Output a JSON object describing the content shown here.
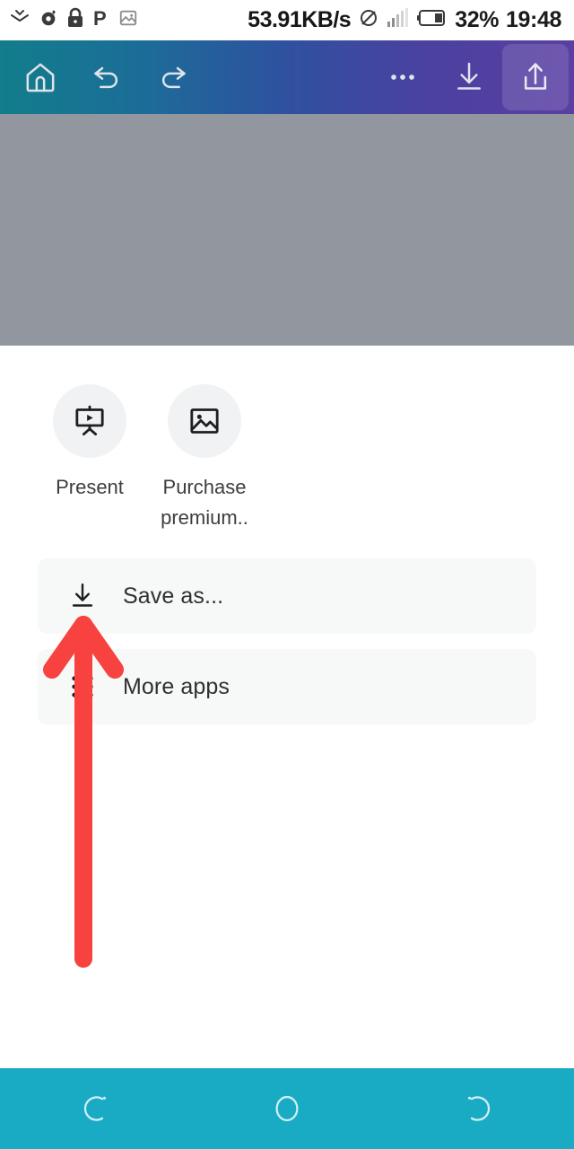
{
  "statusbar": {
    "left_icons": [
      {
        "name": "missed-call-icon"
      },
      {
        "name": "alarm-icon"
      },
      {
        "name": "lock-icon"
      },
      {
        "name": "parking-p-icon"
      },
      {
        "name": "screenshot-image-icon"
      }
    ],
    "network_speed": "53.91KB/s",
    "right_icons": [
      {
        "name": "mute-vibrate-off-icon"
      },
      {
        "name": "signal-bars-icon"
      },
      {
        "name": "battery-icon"
      }
    ],
    "battery_percent": "32%",
    "clock": "19:48"
  },
  "toolbar": {
    "gradient_start": "#127d8b",
    "gradient_end": "#5b3fa2",
    "buttons": [
      {
        "name": "home-icon",
        "label": "Home"
      },
      {
        "name": "undo-icon",
        "label": "Undo"
      },
      {
        "name": "redo-icon",
        "label": "Redo"
      },
      {
        "name": "more-options-icon",
        "label": "More options"
      },
      {
        "name": "download-icon",
        "label": "Download"
      },
      {
        "name": "share-export-icon",
        "label": "Share",
        "selected": true
      }
    ]
  },
  "canvas": {
    "background_color": "#92969e"
  },
  "sheet": {
    "background_color": "#ffffff",
    "quick_actions": [
      {
        "icon": "present-screen-icon",
        "label": "Present"
      },
      {
        "icon": "image-picture-icon",
        "label": "Purchase premium.."
      }
    ],
    "list_items": [
      {
        "icon": "download-icon",
        "label": "Save as..."
      },
      {
        "icon": "apps-grid-icon",
        "label": "More apps"
      }
    ],
    "row_background": "#f7f8f8"
  },
  "annotation": {
    "name": "red-arrow-pointer",
    "color": "#f8423f",
    "points_at": "Save as..."
  },
  "navbar": {
    "background_color": "#1aabc4",
    "buttons": [
      {
        "name": "back-icon",
        "label": "Back"
      },
      {
        "name": "home-circle-icon",
        "label": "Home"
      },
      {
        "name": "recents-icon",
        "label": "Recents"
      }
    ]
  }
}
